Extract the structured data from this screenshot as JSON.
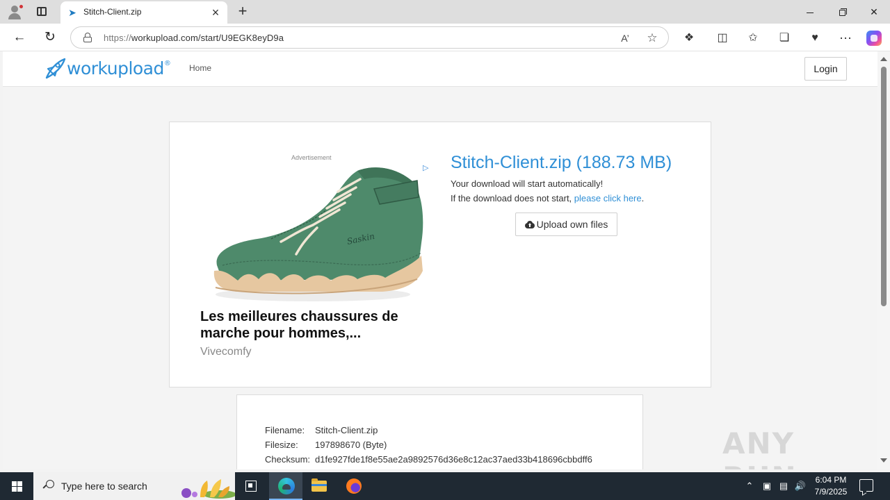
{
  "browser": {
    "tab_title": "Stitch-Client.zip",
    "url_protocol": "https://",
    "url_host_path": "workupload.com/start/U9EGK8eyD9a",
    "read_aloud_label": "A’"
  },
  "site": {
    "logo_text": "workupload",
    "logo_reg": "®",
    "nav_home": "Home",
    "login_label": "Login",
    "brand_color": "#2f8fd6"
  },
  "ad": {
    "label": "Advertisement",
    "headline": "Les meilleures chaussures de marche pour hommes,...",
    "source": "Vivecomfy"
  },
  "download": {
    "title": "Stitch-Client.zip (188.73 MB)",
    "auto_message": "Your download will start automatically!",
    "alt_message": "If the download does not start, ",
    "alt_link": "please click here",
    "alt_suffix": ".",
    "upload_button": "Upload own files"
  },
  "file_info": {
    "filename_label": "Filename:",
    "filename_value": "Stitch-Client.zip",
    "filesize_label": "Filesize:",
    "filesize_value": "197898670 (Byte)",
    "checksum_label": "Checksum:",
    "checksum_value": "d1fe927fde1f8e55ae2a9892576d36e8c12ac37aed33b418696cbbdff6"
  },
  "watermark": "ANY RUN",
  "taskbar": {
    "search_placeholder": "Type here to search",
    "time": "6:04 PM",
    "date": "7/9/2025"
  }
}
